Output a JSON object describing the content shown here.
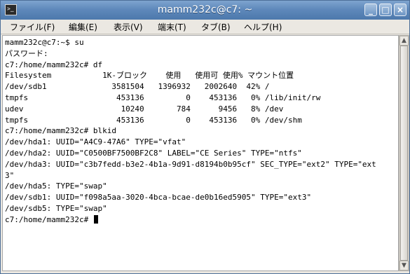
{
  "window": {
    "title": "mamm232c@c7: ~",
    "app_icon_glyph": ">_",
    "controls": {
      "minimize": "_",
      "maximize": "□",
      "close": "×"
    }
  },
  "menubar": {
    "items": [
      "ファイル(F)",
      "編集(E)",
      "表示(V)",
      "端末(T)",
      "タブ(B)",
      "ヘルプ(H)"
    ]
  },
  "terminal": {
    "lines": [
      "mamm232c@c7:~$ su",
      "パスワード:",
      "c7:/home/mamm232c# df",
      "Filesystem           1K-ブロック    使用   使用可 使用% マウント位置",
      "/dev/sdb1              3581504   1396932   2002640  42% /",
      "tmpfs                   453136         0    453136   0% /lib/init/rw",
      "udev                     10240       784      9456   8% /dev",
      "tmpfs                   453136         0    453136   0% /dev/shm",
      "c7:/home/mamm232c# blkid",
      "/dev/hda1: UUID=\"A4C9-47A6\" TYPE=\"vfat\"",
      "/dev/hda2: UUID=\"C0500BF7500BF2C8\" LABEL=\"CE Series\" TYPE=\"ntfs\"",
      "/dev/hda3: UUID=\"c3b7fedd-b3e2-4b1a-9d91-d8194b0b95cf\" SEC_TYPE=\"ext2\" TYPE=\"ext",
      "3\"",
      "/dev/hda5: TYPE=\"swap\"",
      "/dev/sdb1: UUID=\"f098a5aa-3020-4bca-bcae-de0b16ed5905\" TYPE=\"ext3\"",
      "/dev/sdb5: TYPE=\"swap\""
    ],
    "prompt": "c7:/home/mamm232c# "
  },
  "scrollbar": {
    "up_arrow": "▲",
    "down_arrow": "▼"
  },
  "colors": {
    "titlebar": "#5f89bb",
    "terminal_bg": "#ffffff",
    "text": "#000000"
  }
}
